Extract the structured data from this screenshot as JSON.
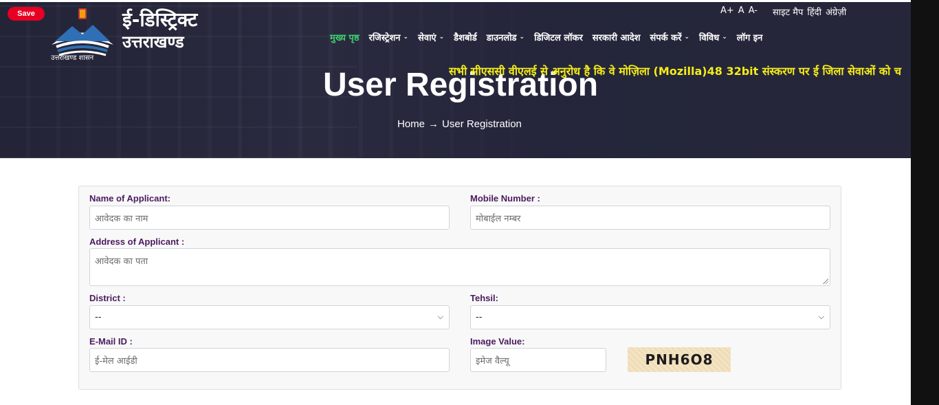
{
  "browser_overlay": {
    "save_label": "Save"
  },
  "header": {
    "logo_caption": "उत्तराखण्ड शासन",
    "brand_line1": "ई-डिस्ट्रिक्ट",
    "brand_line2": "उत्तराखण्ड",
    "utility": {
      "font_larger": "A+",
      "font_normal": "A",
      "font_smaller": "A-",
      "sitemap": "साइट मैप",
      "hindi": "हिंदी",
      "english": "अंग्रेज़ी"
    },
    "nav": [
      {
        "label": "मुख्य पृष्ठ",
        "has_menu": false,
        "active": true
      },
      {
        "label": "रजिस्ट्रेशन",
        "has_menu": true
      },
      {
        "label": "सेवाएं",
        "has_menu": true
      },
      {
        "label": "डैशबोर्ड",
        "has_menu": false
      },
      {
        "label": "डाउनलोड",
        "has_menu": true
      },
      {
        "label": "डिजिटल लॉकर",
        "has_menu": false
      },
      {
        "label": "सरकारी आदेश",
        "has_menu": false
      },
      {
        "label": "संपर्क करें",
        "has_menu": true
      },
      {
        "label": "विविध",
        "has_menu": true
      },
      {
        "label": "लॉग इन",
        "has_menu": false
      }
    ],
    "marquee": "सभी सीएससी वीएलई से अनुरोध है कि वे मोज़िला (Mozilla)48 32bit संस्करण पर ई जिला सेवाओं को च",
    "page_title": "User Registration",
    "breadcrumb": {
      "home": "Home",
      "separator": "→",
      "current": "User Registration"
    }
  },
  "form": {
    "name": {
      "label": "Name of Applicant:",
      "placeholder": "आवेदक का नाम"
    },
    "mobile": {
      "label": "Mobile Number :",
      "placeholder": "मोबाईल नम्बर"
    },
    "address": {
      "label": "Address of Applicant :",
      "placeholder": "आवेदक का पता"
    },
    "district": {
      "label": "District :",
      "selected": "--"
    },
    "tehsil": {
      "label": "Tehsil:",
      "selected": "--"
    },
    "email": {
      "label": "E-Mail ID :",
      "placeholder": "ई-मेल आईडी"
    },
    "image_value": {
      "label": "Image Value:",
      "placeholder": "इमेज वैल्यू"
    },
    "captcha_text": "PNH6O8"
  },
  "colors": {
    "nav_active": "#3ccf6d",
    "marquee": "#f5ec18",
    "label": "#4a1a5e",
    "save": "#e60023"
  }
}
